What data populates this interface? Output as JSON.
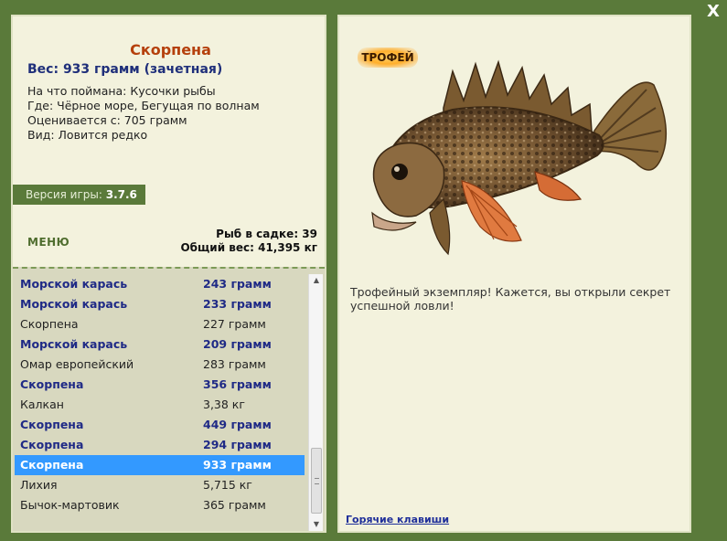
{
  "close_label": "X",
  "fish": {
    "name": "Скорпена",
    "weight_line": "Вес: 933 грамм (зачетная)",
    "bait": "На что поймана: Кусочки рыбы",
    "location": "Где: Чёрное море, Бегущая по волнам",
    "min_weight": "Оценивается с: 705 грамм",
    "rarity": "Вид: Ловится редко"
  },
  "version": {
    "label": "Версия игры: ",
    "value": "3.7.6"
  },
  "menu_label": "МЕНЮ",
  "stats": {
    "count": "Рыб в садке: 39",
    "total_weight": "Общий вес: 41,395 кг"
  },
  "catch_list": [
    {
      "name": "Морской карась",
      "weight": "243 грамм",
      "style": "bold"
    },
    {
      "name": "Морской карась",
      "weight": "233 грамм",
      "style": "bold"
    },
    {
      "name": "Скорпена",
      "weight": "227 грамм",
      "style": "plain"
    },
    {
      "name": "Морской карась",
      "weight": "209 грамм",
      "style": "bold"
    },
    {
      "name": "Омар европейский",
      "weight": "283 грамм",
      "style": "plain"
    },
    {
      "name": "Скорпена",
      "weight": "356 грамм",
      "style": "bold"
    },
    {
      "name": "Калкан",
      "weight": "3,38 кг",
      "style": "plain"
    },
    {
      "name": "Скорпена",
      "weight": "449 грамм",
      "style": "bold"
    },
    {
      "name": "Скорпена",
      "weight": "294 грамм",
      "style": "bold"
    },
    {
      "name": "Скорпена",
      "weight": "933 грамм",
      "style": "selected"
    },
    {
      "name": "Лихия",
      "weight": "5,715 кг",
      "style": "plain"
    },
    {
      "name": "Бычок-мартовик",
      "weight": "365 грамм",
      "style": "plain"
    }
  ],
  "trophy_badge": "ТРОФЕЙ",
  "trophy_text": "Трофейный экземпляр! Кажется, вы открыли секрет успешной ловли!",
  "hotkeys_label": "Горячие клавиши",
  "colors": {
    "frame": "#5a7a3a",
    "panel": "#f3f2dd",
    "list_bg": "#d8d8bf",
    "selected": "#3399ff",
    "title": "#b5400c",
    "bold_fish": "#1f2a86"
  },
  "icons": {
    "close": "close-icon",
    "fish": "scorpionfish-image"
  }
}
